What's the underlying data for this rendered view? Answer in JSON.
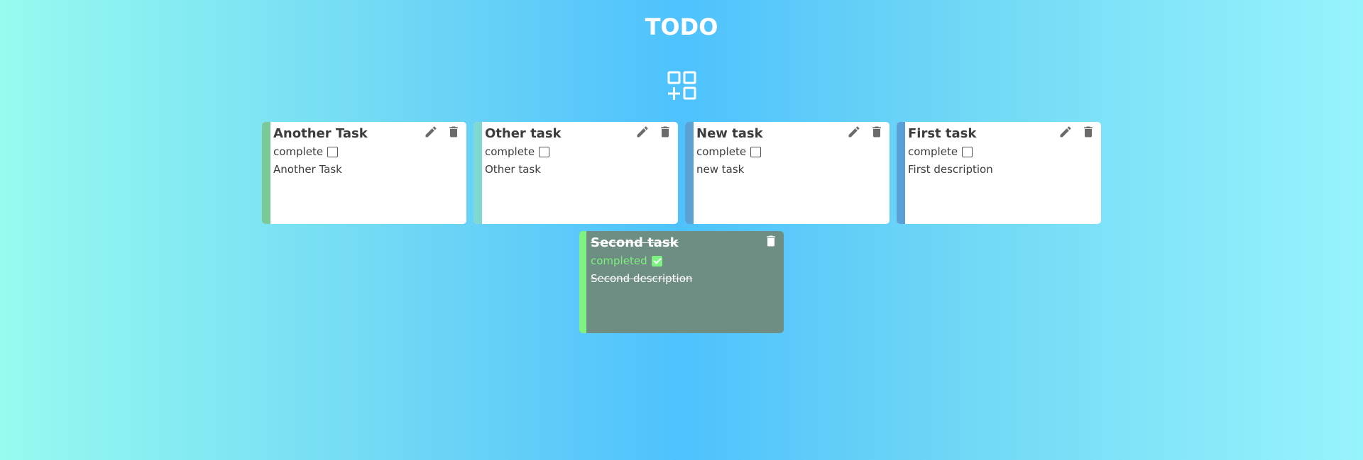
{
  "app": {
    "title": "TODO"
  },
  "add_button": {
    "icon": "add-widget-icon"
  },
  "cards": [
    {
      "title": "Another Task",
      "status": "complete",
      "description": "Another Task",
      "completed": false,
      "stripe_color": "#7ac998"
    },
    {
      "title": "Other task",
      "status": "complete",
      "description": "Other task",
      "completed": false,
      "stripe_color": "#7fd9d2"
    },
    {
      "title": "New task",
      "status": "complete",
      "description": "new task",
      "completed": false,
      "stripe_color": "#5aa2d4"
    },
    {
      "title": "First task",
      "status": "complete",
      "description": "First description",
      "completed": false,
      "stripe_color": "#5a9fd6"
    },
    {
      "title": "Second task",
      "status": "completed",
      "description": "Second description",
      "completed": true,
      "stripe_color": "#7ef282"
    }
  ],
  "colors": {
    "completed_card_bg": "#6f8e83",
    "completed_status_text": "#7bf07a",
    "icon_gray": "#6b6b6b"
  }
}
